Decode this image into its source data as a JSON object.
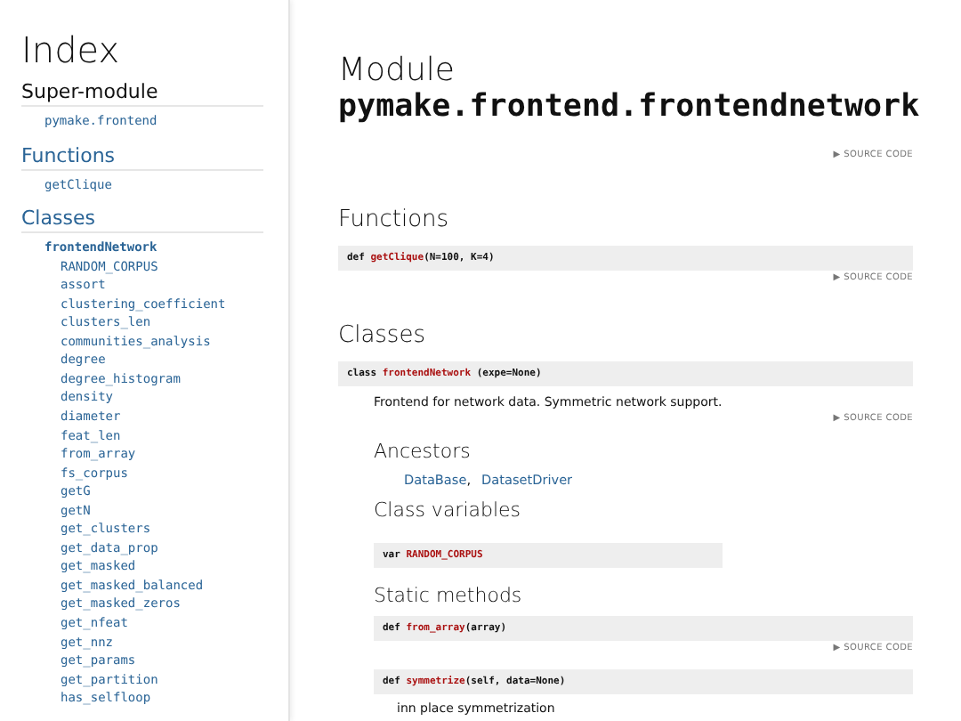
{
  "sidebar": {
    "title": "Index",
    "sections": [
      {
        "heading": "Super-module",
        "is_link": false,
        "items": [
          {
            "label": "pymake.frontend"
          }
        ]
      },
      {
        "heading": "Functions",
        "is_link": true,
        "items": [
          {
            "label": "getClique"
          }
        ]
      },
      {
        "heading": "Classes",
        "is_link": true,
        "items": [
          {
            "label": "frontendNetwork",
            "children": [
              {
                "label": "RANDOM_CORPUS"
              },
              {
                "label": "assort"
              },
              {
                "label": "clustering_coefficient"
              },
              {
                "label": "clusters_len"
              },
              {
                "label": "communities_analysis"
              },
              {
                "label": "degree"
              },
              {
                "label": "degree_histogram"
              },
              {
                "label": "density"
              },
              {
                "label": "diameter"
              },
              {
                "label": "feat_len"
              },
              {
                "label": "from_array"
              },
              {
                "label": "fs_corpus"
              },
              {
                "label": "getG"
              },
              {
                "label": "getN"
              },
              {
                "label": "get_clusters"
              },
              {
                "label": "get_data_prop"
              },
              {
                "label": "get_masked"
              },
              {
                "label": "get_masked_balanced"
              },
              {
                "label": "get_masked_zeros"
              },
              {
                "label": "get_nfeat"
              },
              {
                "label": "get_nnz"
              },
              {
                "label": "get_params"
              },
              {
                "label": "get_partition"
              },
              {
                "label": "has_selfloop"
              }
            ]
          }
        ]
      }
    ]
  },
  "main": {
    "title": "Module",
    "module_name": "pymake.frontend.frontendnetwork",
    "source_toggle": {
      "arrow": "▶",
      "label": "SOURCE CODE"
    },
    "sections": [
      {
        "heading": "Functions",
        "items": [
          {
            "kind": "signature",
            "keyword": "def",
            "name": "getClique",
            "args": "(N=100, K=4)"
          },
          {
            "kind": "source",
            "arrow": "▶",
            "label": "SOURCE CODE"
          }
        ]
      },
      {
        "heading": "Classes",
        "items": [
          {
            "kind": "signature",
            "keyword": "class",
            "name": "frontendNetwork",
            "args": " (expe=None)"
          },
          {
            "kind": "body",
            "children": [
              {
                "kind": "text",
                "text": "Frontend for network data. Symmetric network support."
              },
              {
                "kind": "source",
                "arrow": "▶",
                "label": "SOURCE CODE"
              },
              {
                "kind": "subheading",
                "text": "Ancestors"
              },
              {
                "kind": "links",
                "separator": ",",
                "links": [
                  "DataBase",
                  "DatasetDriver"
                ]
              },
              {
                "kind": "subheading",
                "text": "Class variables"
              },
              {
                "kind": "variable",
                "keyword": "var",
                "name": "RANDOM_CORPUS"
              },
              {
                "kind": "subheading",
                "text": "Static methods"
              },
              {
                "kind": "signature",
                "keyword": "def",
                "name": "from_array",
                "args": "(array)"
              },
              {
                "kind": "source",
                "arrow": "▶",
                "label": "SOURCE CODE"
              },
              {
                "kind": "signature",
                "keyword": "def",
                "name": "symmetrize",
                "args": "(self, data=None)"
              },
              {
                "kind": "docstring",
                "text": "inn place symmetrization"
              }
            ]
          }
        ]
      }
    ]
  }
}
